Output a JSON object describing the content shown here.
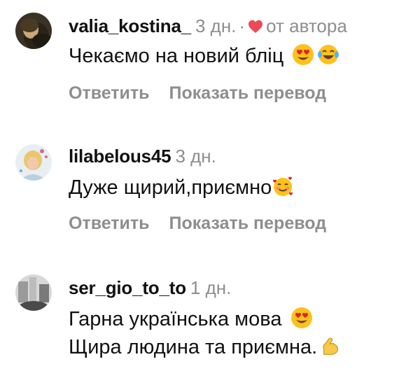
{
  "comments": [
    {
      "username": "valia_kostina_",
      "time": "3 дн.",
      "separator": "·",
      "author_like_label": "от автора",
      "text": "Чекаємо на новий бліц",
      "emojis": [
        "heart-eyes-emoji",
        "laughing-tears-emoji"
      ],
      "reply_label": "Ответить",
      "translate_label": "Показать перевод"
    },
    {
      "username": "lilabelous45",
      "time": "3 дн.",
      "text": "Дуже щирий,приємно",
      "emojis": [
        "smiling-hearts-emoji"
      ],
      "reply_label": "Ответить",
      "translate_label": "Показать перевод"
    },
    {
      "username": "ser_gio_to_to",
      "time": "1 дн.",
      "text_line1": "Гарна українська мова",
      "text_line2": "Щира людина та приємна.",
      "emojis": [
        "heart-eyes-emoji",
        "flexed-biceps-emoji"
      ]
    }
  ],
  "colors": {
    "text": "#111111",
    "muted": "#8e8e8e",
    "heart": "#ed4956"
  }
}
